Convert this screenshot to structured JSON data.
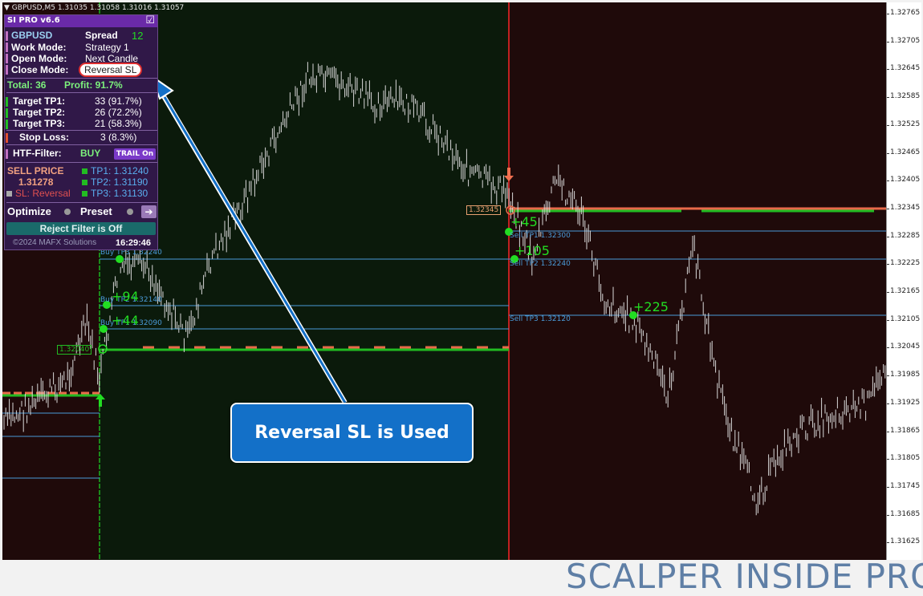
{
  "header": {
    "symbol_line": "GBPUSD,M5  1.31035 1.31058 1.31016 1.31057"
  },
  "axis": {
    "ticks": [
      "1.32765",
      "1.32705",
      "1.32645",
      "1.32585",
      "1.32525",
      "1.32465",
      "1.32405",
      "1.32345",
      "1.32285",
      "1.32225",
      "1.32165",
      "1.32105",
      "1.32045",
      "1.31985",
      "1.31925",
      "1.31865",
      "1.31805",
      "1.31745",
      "1.31685",
      "1.31625"
    ]
  },
  "panel": {
    "title": "SI PRO v6.6",
    "checkbox": "☑",
    "pair": "GBPUSD",
    "spread_label": "Spread",
    "spread_value": "12",
    "work_mode_label": "Work  Mode:",
    "work_mode_value": "Strategy 1",
    "open_mode_label": "Open  Mode:",
    "open_mode_value": "Next Candle",
    "close_mode_label": "Close Mode:",
    "close_mode_value": "Reversal SL",
    "total_label": "Total: 36",
    "profit_label": "Profit: 91.7%",
    "tp1_label": "Target TP1:",
    "tp1_value": "33 (91.7%)",
    "tp2_label": "Target TP2:",
    "tp2_value": "26 (72.2%)",
    "tp3_label": "Target TP3:",
    "tp3_value": "21 (58.3%)",
    "sl_label": "Stop Loss:",
    "sl_value": "3 (8.3%)",
    "htf_label": "HTF-Filter:",
    "htf_value": "BUY",
    "trail_button": "TRAIL On",
    "sell_price_label": "SELL PRICE",
    "sell_price_value": "1.31278",
    "sl_reversal": "SL: Reversal",
    "tp1_price": "TP1: 1.31240",
    "tp2_price": "TP2: 1.31190",
    "tp3_price": "TP3: 1.31130",
    "optimize_label": "Optimize",
    "preset_label": "Preset",
    "arrow_button": "➔",
    "reject_filter": "Reject Filter is Off",
    "copyright": "©2024 MAFX Solutions",
    "clock": "16:29:46"
  },
  "chart_tags": {
    "buy_tp3": "Buy TP3 1.32240",
    "buy_tp2": "Buy TP2 1.32140",
    "buy_tp1": "Buy TP1 1.32090",
    "buy_entry": "1.32040",
    "sell_entry": "1.32345",
    "sell_tp1": "Sell TP1 1.32300",
    "sell_tp2": "Sell TP2 1.32240",
    "sell_tp3": "Sell TP3 1.32120",
    "pnl_94": "+94",
    "pnl_44": "+44",
    "pnl_45": "+45",
    "pnl_105": "+105",
    "pnl_225": "+225"
  },
  "callout": {
    "text": "Reversal SL is Used"
  },
  "brand": "SCALPER INSIDE PRO",
  "colors": {
    "bear_zone": "#1f0a0a",
    "bull_zone": "#0b1a0b",
    "buy_line": "#22bb22",
    "sell_line": "#e86a4a",
    "tp_line": "#4a9ad8",
    "callout_bg": "#1370c8"
  }
}
